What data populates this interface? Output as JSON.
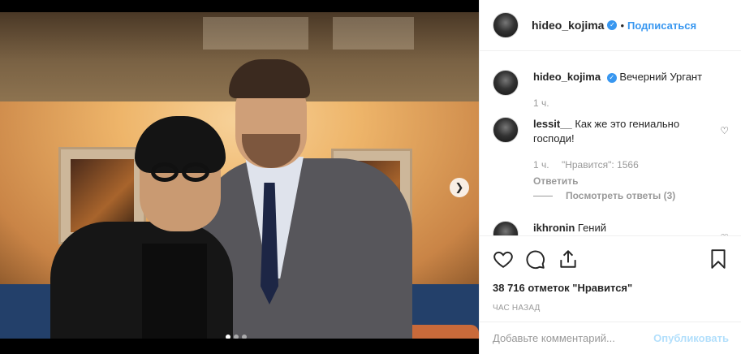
{
  "header": {
    "username": "hideo_kojima",
    "verified_icon": "verified-badge-icon",
    "separator": "•",
    "follow_label": "Подписаться"
  },
  "caption": {
    "username": "hideo_kojima",
    "text": "Вечерний Ургант",
    "time": "1 ч."
  },
  "comments": [
    {
      "username": "lessit__",
      "text": "Как же это гениально господи!",
      "time": "1 ч.",
      "likes": "\"Нравится\": 1566",
      "reply_label": "Ответить",
      "view_replies": "Посмотреть ответы (3)"
    },
    {
      "username": "ikhronin",
      "text": "Гений"
    }
  ],
  "carousel": {
    "next_icon": "chevron-right-icon",
    "slides": 3,
    "active_slide": 1
  },
  "likes_text": "38 716 отметок \"Нравится\"",
  "time_ago": "ЧАС НАЗАД",
  "add_comment": {
    "placeholder": "Добавьте комментарий...",
    "post_label": "Опубликовать"
  },
  "colors": {
    "accent": "#3897f0",
    "post_disabled": "#b2dffc",
    "muted": "#999999"
  }
}
